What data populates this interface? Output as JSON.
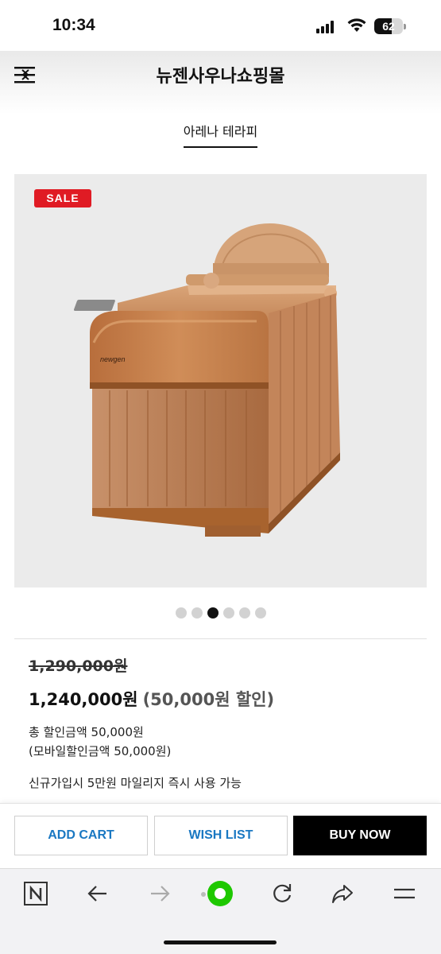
{
  "status_bar": {
    "time": "10:34",
    "battery": "62",
    "battery_level": 0.62
  },
  "header": {
    "title": "뉴젠사우나쇼핑몰",
    "menu_icon": "menu-icon"
  },
  "category": {
    "label": "아레나 테라피"
  },
  "product": {
    "sale_badge": "SALE",
    "image_brand_text": "newgen",
    "carousel": {
      "count": 6,
      "active_index": 2
    },
    "original_price": "1,290,000원",
    "sale_price": "1,240,000원",
    "discount_text": "(50,000원 할인)",
    "total_discount": "총 할인금액 50,000원",
    "mobile_discount": "(모바일할인금액 50,000원)",
    "mileage_note": "신규가입시 5만원 마일리지 즉시 사용 가능"
  },
  "actions": {
    "add_cart": "ADD CART",
    "wish_list": "WISH LIST",
    "buy_now": "BUY NOW"
  },
  "browser_toolbar": {
    "icons": [
      "naver-n-icon",
      "back-arrow-icon",
      "forward-arrow-icon",
      "green-dot-icon",
      "reload-icon",
      "share-icon",
      "menu-lines-icon"
    ]
  },
  "colors": {
    "sale_red": "#e01b24",
    "link_blue": "#1a78c2",
    "buy_black": "#000000",
    "wood": "#c07a45",
    "naver_green": "#1ec800"
  }
}
